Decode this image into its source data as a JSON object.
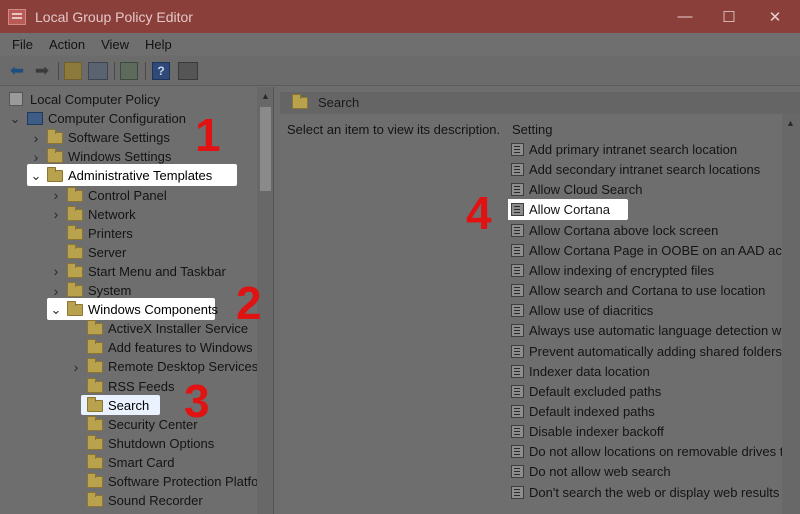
{
  "window": {
    "title": "Local Group Policy Editor",
    "controls": {
      "minimize": "—",
      "maximize": "☐",
      "close": "✕"
    }
  },
  "menu": [
    "File",
    "Action",
    "View",
    "Help"
  ],
  "toolbar": {
    "icons": [
      "back-arrow-icon",
      "forward-arrow-icon",
      "up-folder-icon",
      "show-tree-icon",
      "export-list-icon",
      "help-icon",
      "filter-icon"
    ],
    "help_glyph": "?"
  },
  "tree": {
    "items": [
      {
        "label": "Local Computer Policy",
        "level": 0,
        "expander": "none",
        "icon": "policy"
      },
      {
        "label": "Computer Configuration",
        "level": 0,
        "expander": "expanded",
        "icon": "computer"
      },
      {
        "label": "Software Settings",
        "level": 1,
        "expander": "collapsed",
        "icon": "folder"
      },
      {
        "label": "Windows Settings",
        "level": 1,
        "expander": "collapsed",
        "icon": "folder"
      },
      {
        "label": "Administrative Templates",
        "level": 1,
        "expander": "expanded",
        "icon": "folder",
        "highlight": true
      },
      {
        "label": "Control Panel",
        "level": 2,
        "expander": "collapsed",
        "icon": "folder"
      },
      {
        "label": "Network",
        "level": 2,
        "expander": "collapsed",
        "icon": "folder"
      },
      {
        "label": "Printers",
        "level": 2,
        "expander": "none",
        "icon": "folder"
      },
      {
        "label": "Server",
        "level": 2,
        "expander": "none",
        "icon": "folder"
      },
      {
        "label": "Start Menu and Taskbar",
        "level": 2,
        "expander": "collapsed",
        "icon": "folder"
      },
      {
        "label": "System",
        "level": 2,
        "expander": "collapsed",
        "icon": "folder"
      },
      {
        "label": "Windows Components",
        "level": 2,
        "expander": "expanded",
        "icon": "folder",
        "highlight": true
      },
      {
        "label": "ActiveX Installer Service",
        "level": 3,
        "expander": "none",
        "icon": "folder"
      },
      {
        "label": "Add features to Windows",
        "level": 3,
        "expander": "none",
        "icon": "folder"
      },
      {
        "label": "Remote Desktop Services",
        "level": 3,
        "expander": "collapsed",
        "icon": "folder"
      },
      {
        "label": "RSS Feeds",
        "level": 3,
        "expander": "none",
        "icon": "folder"
      },
      {
        "label": "Search",
        "level": 3,
        "expander": "none",
        "icon": "folder",
        "selected": true
      },
      {
        "label": "Security Center",
        "level": 3,
        "expander": "none",
        "icon": "folder"
      },
      {
        "label": "Shutdown Options",
        "level": 3,
        "expander": "none",
        "icon": "folder"
      },
      {
        "label": "Smart Card",
        "level": 3,
        "expander": "none",
        "icon": "folder"
      },
      {
        "label": "Software Protection Platfo",
        "level": 3,
        "expander": "none",
        "icon": "folder"
      },
      {
        "label": "Sound Recorder",
        "level": 3,
        "expander": "none",
        "icon": "folder"
      }
    ]
  },
  "right_pane": {
    "header_title": "Search",
    "description": "Select an item to view its description.",
    "column_header": "Setting",
    "settings": [
      "Add primary intranet search location",
      "Add secondary intranet search locations",
      "Allow Cloud Search",
      "Allow Cortana",
      "Allow Cortana above lock screen",
      "Allow Cortana Page in OOBE on an AAD acco",
      "Allow indexing of encrypted files",
      "Allow search and Cortana to use location",
      "Allow use of diacritics",
      "Always use automatic language detection wh",
      "Prevent automatically adding shared folders t",
      "Indexer data location",
      "Default excluded paths",
      "Default indexed paths",
      "Disable indexer backoff",
      "Do not allow locations on removable drives t",
      "Do not allow web search",
      "Don't search the web or display web results in"
    ],
    "highlighted_setting": "Allow Cortana"
  },
  "callouts": [
    "1",
    "2",
    "3",
    "4"
  ],
  "colors": {
    "callout": "#e01212",
    "highlight": "#ffffff",
    "titlebar": "#8a3f3b"
  }
}
